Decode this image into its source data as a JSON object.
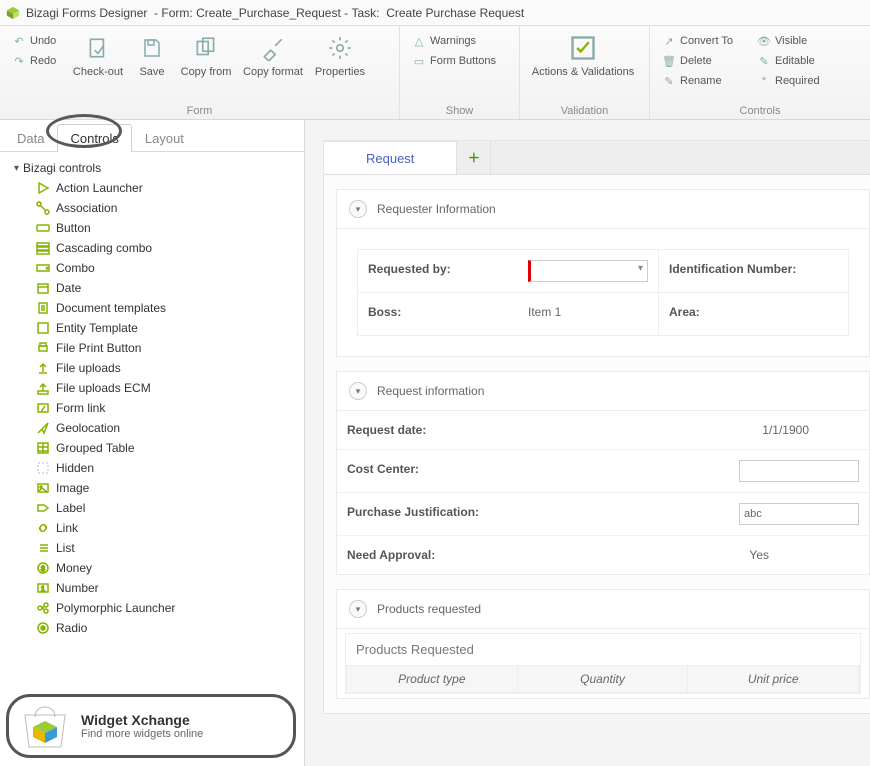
{
  "titlebar": {
    "app": "Bizagi Forms Designer",
    "form_label": "Form:",
    "form_name": "Create_Purchase_Request",
    "task_label": "Task:",
    "task_name": "Create Purchase Request"
  },
  "ribbon": {
    "undo": "Undo",
    "redo": "Redo",
    "checkout": "Check-out",
    "save": "Save",
    "copyfrom": "Copy from",
    "copyformat": "Copy format",
    "properties": "Properties",
    "group_form": "Form",
    "warnings": "Warnings",
    "formbuttons": "Form Buttons",
    "group_show": "Show",
    "actions": "Actions & Validations",
    "group_validation": "Validation",
    "convert": "Convert To",
    "delete": "Delete",
    "rename": "Rename",
    "visible": "Visible",
    "editable": "Editable",
    "required": "Required",
    "group_controls": "Controls"
  },
  "left": {
    "tabs": {
      "data": "Data",
      "controls": "Controls",
      "layout": "Layout"
    },
    "root": "Bizagi controls",
    "items": [
      {
        "icon": "play",
        "label": "Action Launcher"
      },
      {
        "icon": "assoc",
        "label": "Association"
      },
      {
        "icon": "button",
        "label": "Button"
      },
      {
        "icon": "cascade",
        "label": "Cascading combo"
      },
      {
        "icon": "combo",
        "label": "Combo"
      },
      {
        "icon": "date",
        "label": "Date"
      },
      {
        "icon": "doct",
        "label": "Document templates"
      },
      {
        "icon": "entity",
        "label": "Entity Template"
      },
      {
        "icon": "print",
        "label": "File Print Button"
      },
      {
        "icon": "upload",
        "label": "File uploads"
      },
      {
        "icon": "uploadecm",
        "label": "File uploads ECM"
      },
      {
        "icon": "formlink",
        "label": "Form link"
      },
      {
        "icon": "geo",
        "label": "Geolocation"
      },
      {
        "icon": "gtable",
        "label": "Grouped Table"
      },
      {
        "icon": "hidden",
        "label": "Hidden"
      },
      {
        "icon": "image",
        "label": "Image"
      },
      {
        "icon": "label",
        "label": "Label"
      },
      {
        "icon": "link",
        "label": "Link"
      },
      {
        "icon": "list",
        "label": "List"
      },
      {
        "icon": "money",
        "label": "Money"
      },
      {
        "icon": "number",
        "label": "Number"
      },
      {
        "icon": "poly",
        "label": "Polymorphic Launcher"
      },
      {
        "icon": "radio",
        "label": "Radio"
      }
    ],
    "xchange": {
      "title": "Widget Xchange",
      "subtitle": "Find more widgets online"
    }
  },
  "form": {
    "tab": "Request",
    "sec1": {
      "title": "Requester Information",
      "requested_by": "Requested by:",
      "boss": "Boss:",
      "boss_val": "Item 1",
      "idnum": "Identification Number:",
      "area": "Area:"
    },
    "sec2": {
      "title": "Request information",
      "reqdate": "Request date:",
      "reqdate_val": "1/1/1900",
      "cost": "Cost Center:",
      "just": "Purchase Justification:",
      "just_val": "abc",
      "need": "Need Approval:",
      "need_val": "Yes"
    },
    "sec3": {
      "title": "Products requested",
      "grid_title": "Products Requested",
      "cols": {
        "c1": "Product type",
        "c2": "Quantity",
        "c3": "Unit price"
      }
    }
  }
}
